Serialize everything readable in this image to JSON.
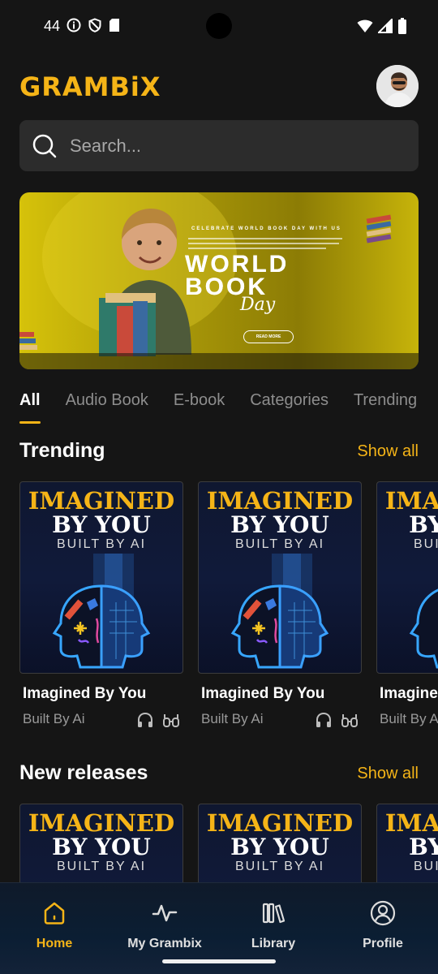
{
  "status_bar": {
    "time": "44",
    "icons": [
      "info-icon",
      "shield-icon",
      "sim-card-icon",
      "wifi-icon",
      "signal-icon",
      "battery-icon"
    ]
  },
  "header": {
    "logo": "GRAMBiX",
    "avatar": "user-avatar"
  },
  "search": {
    "placeholder": "Search..."
  },
  "banner": {
    "tagline": "CELEBRATE WORLD BOOK DAY WITH US",
    "word1": "WORLD",
    "word2": "BOOK",
    "word3": "Day",
    "button": "READ MORE"
  },
  "tabs": [
    {
      "label": "All",
      "active": true
    },
    {
      "label": "Audio Book",
      "active": false
    },
    {
      "label": "E-book",
      "active": false
    },
    {
      "label": "Categories",
      "active": false
    },
    {
      "label": "Trending",
      "active": false
    }
  ],
  "trending": {
    "title": "Trending",
    "show_all": "Show all",
    "cards": [
      {
        "cover_line1": "IMAGINED",
        "cover_line2": "BY YOU",
        "cover_line3": "BUILT BY AI",
        "title": "Imagined By You",
        "subtitle": "Built By Ai"
      },
      {
        "cover_line1": "IMAGINED",
        "cover_line2": "BY YOU",
        "cover_line3": "BUILT BY AI",
        "title": "Imagined By You",
        "subtitle": "Built By Ai"
      },
      {
        "cover_line1": "IMAGINED",
        "cover_line2": "BY YOU",
        "cover_line3": "BUILT BY AI",
        "title": "Imagined By You",
        "subtitle": "Built By Ai"
      }
    ]
  },
  "new_releases": {
    "title": "New releases",
    "show_all": "Show all",
    "cards": [
      {
        "cover_line1": "IMAGINED",
        "cover_line2": "BY YOU",
        "cover_line3": "BUILT BY AI"
      },
      {
        "cover_line1": "IMAGINED",
        "cover_line2": "BY YOU",
        "cover_line3": "BUILT BY AI"
      },
      {
        "cover_line1": "IMAGINED",
        "cover_line2": "BY YOU",
        "cover_line3": "BUILT BY AI"
      }
    ]
  },
  "bottom_nav": [
    {
      "label": "Home",
      "icon": "home-icon",
      "active": true
    },
    {
      "label": "My Grambix",
      "icon": "activity-icon",
      "active": false
    },
    {
      "label": "Library",
      "icon": "library-icon",
      "active": false
    },
    {
      "label": "Profile",
      "icon": "profile-icon",
      "active": false
    }
  ],
  "colors": {
    "accent": "#f5b417",
    "background": "#151515",
    "search_bg": "#2c2c2c"
  }
}
